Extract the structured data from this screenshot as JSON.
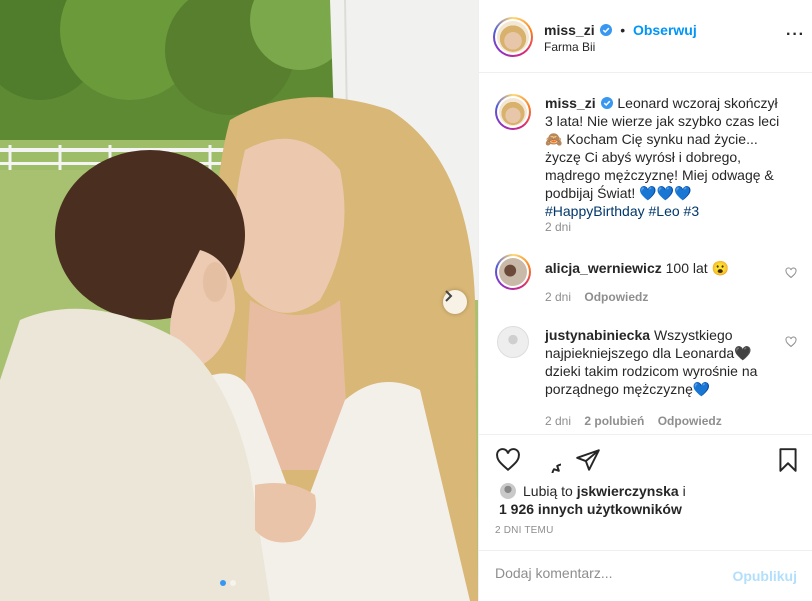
{
  "post": {
    "username": "miss_zi",
    "follow_label": "Obserwuj",
    "location": "Farma Bii",
    "more_icon": "more-options-icon"
  },
  "caption": {
    "username": "miss_zi",
    "text": "Leonard wczoraj skończył 3 lata! Nie wierze jak szybko czas leci 🙈 Kocham Cię synku nad życie... życzę Ci abyś wyrósł i dobrego, mądrego mężczyznę! Miej odwagę & podbijaj Świat! 💙💙💙",
    "hashtags": "#HappyBirthday #Leo #3",
    "time": "2 dni"
  },
  "comments": [
    {
      "username": "alicja_werniewicz",
      "text": "100 lat 😮",
      "time": "2 dni",
      "likes": "",
      "reply": "Odpowiedz"
    },
    {
      "username": "justynabiniecka",
      "text": "Wszystkiego najpiekniejszego dla Leonarda🖤 dzieki takim rodzicom wyrośnie na porządnego mężczyznę💙",
      "time": "2 dni",
      "likes": "2 polubień",
      "reply": "Odpowiedz"
    }
  ],
  "likes": {
    "prefix": "Lubią to",
    "user": "jskwierczynska",
    "conjunction": "i",
    "others": "1 926 innych użytkowników"
  },
  "timestamp": "2 DNI TEMU",
  "add_comment": {
    "placeholder": "Dodaj komentarz...",
    "publish_label": "Opublikuj"
  },
  "colors": {
    "link": "#0095f6",
    "hashtag": "#00376b",
    "meta": "#8e8e8e"
  }
}
